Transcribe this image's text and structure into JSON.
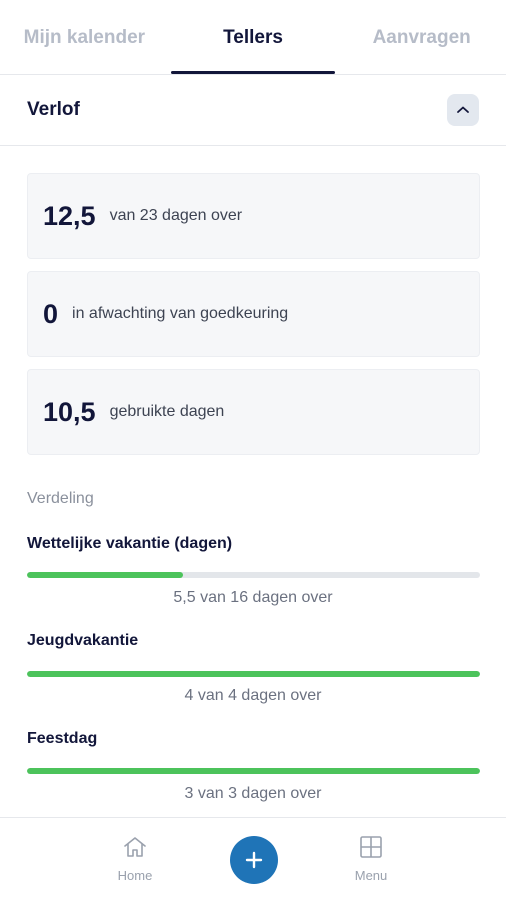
{
  "tabs": [
    {
      "label": "Mijn kalender",
      "active": false
    },
    {
      "label": "Tellers",
      "active": true
    },
    {
      "label": "Aanvragen",
      "active": false
    }
  ],
  "section": {
    "title": "Verlof",
    "toggle_icon": "chevron-up-icon"
  },
  "summary": [
    {
      "value": "12,5",
      "text": "van 23 dagen over"
    },
    {
      "value": "0",
      "text": "in afwachting van goedkeuring"
    },
    {
      "value": "10,5",
      "text": "gebruikte dagen"
    }
  ],
  "distribution": {
    "label": "Verdeling",
    "buckets": [
      {
        "name": "Wettelijke vakantie (dagen)",
        "remaining_fraction": 0.344,
        "subtitle": "5,5 van 16 dagen over"
      },
      {
        "name": "Jeugdvakantie",
        "remaining_fraction": 1.0,
        "subtitle": "4 van 4 dagen over"
      },
      {
        "name": "Feestdag",
        "remaining_fraction": 1.0,
        "subtitle": "3 van 3 dagen over"
      }
    ]
  },
  "bottom_nav": {
    "home": {
      "label": "Home",
      "icon": "home-icon"
    },
    "add": {
      "icon": "plus-icon"
    },
    "menu": {
      "label": "Menu",
      "icon": "grid-icon"
    }
  },
  "colors": {
    "accent": "#1f74b7",
    "progress": "#4cc35b",
    "text_dark": "#12163a"
  }
}
